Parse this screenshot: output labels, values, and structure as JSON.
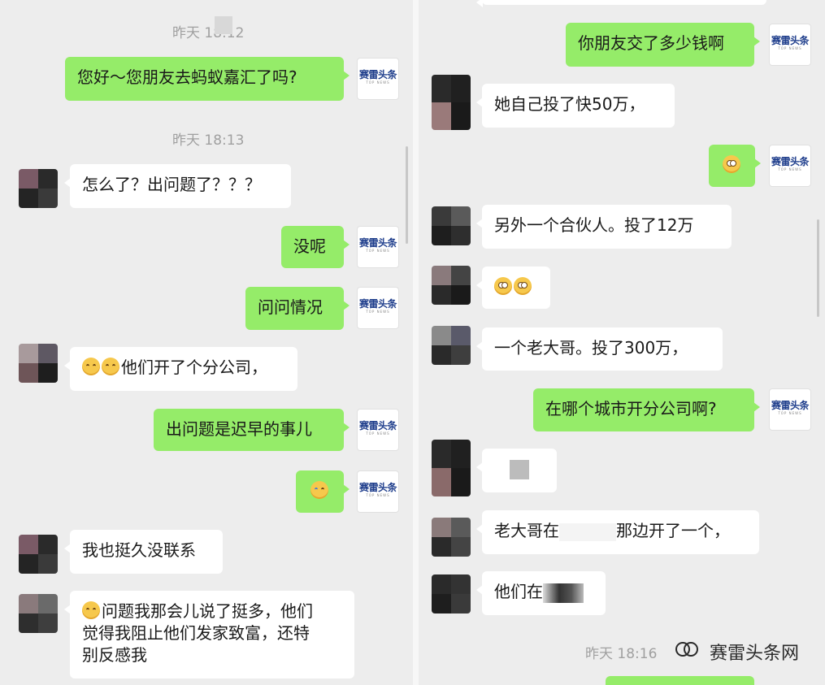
{
  "colors": {
    "background": "#ededed",
    "bubble_self": "#95ec69",
    "bubble_other": "#ffffff",
    "timestamp": "#a0a0a0",
    "logo_blue": "#1f3e8c"
  },
  "self_avatar": {
    "logo_text": "赛雷头条",
    "logo_sub": "TOP NEWS",
    "icon": "brand-logo-icon"
  },
  "left": {
    "timestamps": [
      "昨天 18:12",
      "昨天 18:13"
    ],
    "messages": [
      {
        "side": "self",
        "text": "您好～您朋友去蚂蚁嘉汇了吗?"
      },
      {
        "side": "other",
        "text": "怎么了？出问题了？？？"
      },
      {
        "side": "self",
        "text": "没呢"
      },
      {
        "side": "self",
        "text": "问问情况"
      },
      {
        "side": "other",
        "emoji_prefix": [
          "sleepy-emoji-icon",
          "sleepy-emoji-icon"
        ],
        "text": "他们开了个分公司，"
      },
      {
        "side": "self",
        "text": "出问题是迟早的事儿"
      },
      {
        "side": "self",
        "emoji_only": "crying-laughing-emoji-icon"
      },
      {
        "side": "other",
        "text": "我也挺久没联系"
      },
      {
        "side": "other",
        "emoji_prefix": [
          "sleepy-emoji-icon"
        ],
        "lines": [
          "问题我那会儿说了挺多，他们",
          "觉得我阻止他们发家致富，还特",
          "别反感我"
        ]
      }
    ]
  },
  "right": {
    "timestamps": [
      "昨天 18:16"
    ],
    "messages": [
      {
        "side": "self",
        "text": "你朋友交了多少钱啊"
      },
      {
        "side": "other",
        "text": "她自己投了快50万，"
      },
      {
        "side": "self",
        "emoji_only": "flushed-emoji-icon"
      },
      {
        "side": "other",
        "text": "另外一个合伙人。投了12万"
      },
      {
        "side": "other",
        "emoji_only": [
          "flushed-emoji-icon",
          "flushed-emoji-icon"
        ]
      },
      {
        "side": "other",
        "text": "一个老大哥。投了300万，"
      },
      {
        "side": "self",
        "text": "在哪个城市开分公司啊?"
      },
      {
        "side": "other",
        "text": ""
      },
      {
        "side": "other",
        "text_before": "老大哥在",
        "text_after": "那边开了一个，"
      },
      {
        "side": "other",
        "text": "他们在"
      }
    ]
  },
  "watermark": {
    "text": "赛雷头条网",
    "icon": "wechat-channel-icon"
  }
}
